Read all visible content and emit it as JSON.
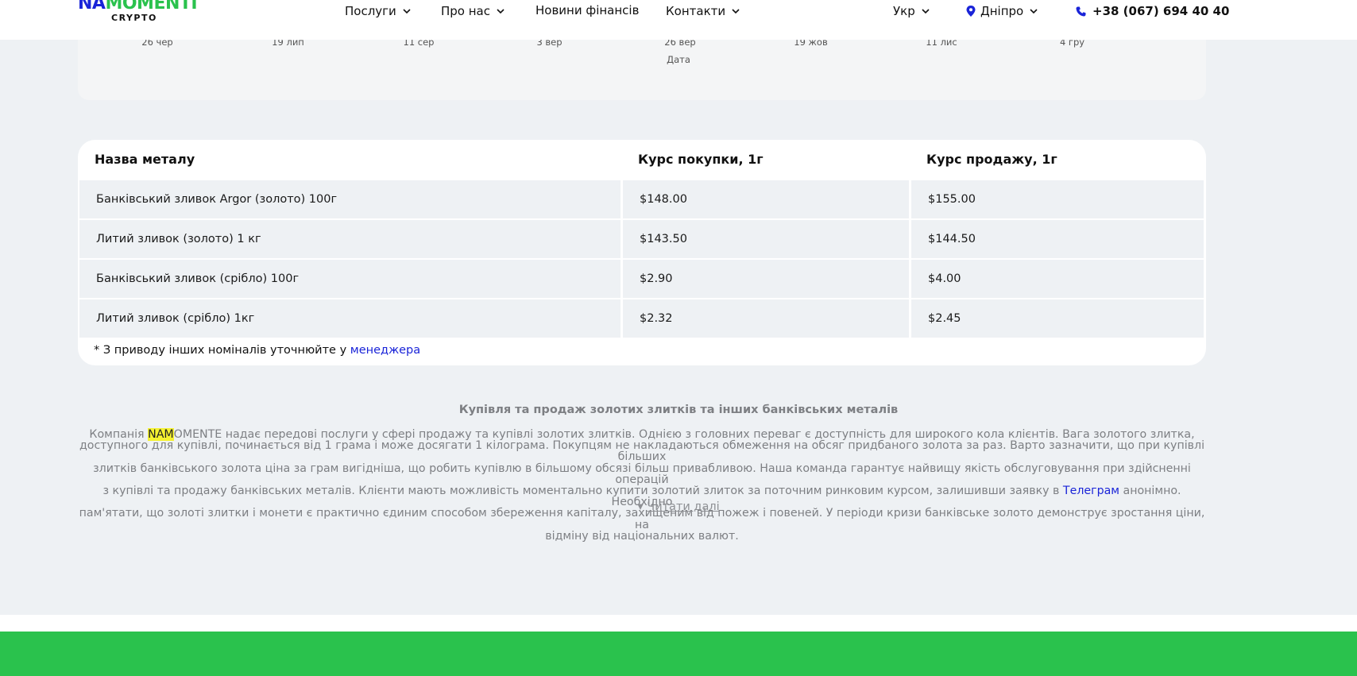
{
  "header": {
    "logo_top": "NA",
    "logo_top_accent": "MOMENTI",
    "logo_sub": "CRYPTO",
    "nav": {
      "services": "Послуги",
      "about": "Про нас",
      "news": "Новини фінансів",
      "contacts": "Контакти"
    },
    "language": "Укр",
    "city": "Дніпро",
    "phone": "+38 (067) 694 40 40"
  },
  "chart_data": {
    "type": "line",
    "x_tick_labels": [
      "26 чер",
      "19 лип",
      "11 сер",
      "3 вер",
      "26 вер",
      "19 жов",
      "11 лис",
      "4 гру"
    ],
    "xlabel": "Дата"
  },
  "metals_table": {
    "headers": {
      "name": "Назва металу",
      "buy": "Курс покупки, 1г",
      "sell": "Курс продажу, 1г"
    },
    "rows": [
      {
        "name": "Банківський зливок Argor (золото) 100г",
        "buy": "$148.00",
        "sell": "$155.00"
      },
      {
        "name": "Литий зливок (золото) 1 кг",
        "buy": "$143.50",
        "sell": "$144.50"
      },
      {
        "name": "Банківський зливок (срібло) 100г",
        "buy": "$2.90",
        "sell": "$4.00"
      },
      {
        "name": "Литий зливок (срібло) 1кг",
        "buy": "$2.32",
        "sell": "$2.45"
      }
    ],
    "note_prefix": "* З приводу інших номіналів уточнюйте у ",
    "note_link": "менеджера"
  },
  "seo": {
    "title": "Купівля та продаж золотих злитків та інших банківських металів",
    "line1_pre": "Компанія ",
    "line1_hl": "NAM",
    "line1_post": "OMENTE надає передові послуги у сфері продажу та купівлі золотих злитків. Однією з головних переваг є доступність для широкого кола клієнтів. Вага золотого злитка,",
    "line2": "доступного для купівлі, починається від 1 грама і може досягати 1 кілограма. Покупцям не накладаються обмеження на обсяг придбаного золота за раз. Варто зазначити, що при купівлі більших",
    "line3": "злитків банківського золота ціна за грам вигідніша, що робить купівлю в більшому обсязі більш привабливою. Наша команда гарантує найвищу якість обслуговування при здійсненні операцій",
    "line4_pre": "з купівлі та продажу банківських металів. Клієнти мають можливість моментально купити золотий злиток за поточним ринковим курсом, залишивши заявку в ",
    "line4_link": "Телеграм",
    "line4_post": " анонімно. Необхідно",
    "line5": "пам'ятати, що золоті злитки і монети є практично єдиним способом збереження капіталу, захищеним від пожеж і повеней. У періоди кризи банківське золото демонструє зростання ціни, на",
    "line6": "відміну від національних валют.",
    "read_more_arrow": "▾",
    "read_more": "Читати далі"
  },
  "colors": {
    "brand_blue": "#1a24d8",
    "brand_green": "#2ac24d",
    "highlight": "#f5f230"
  }
}
